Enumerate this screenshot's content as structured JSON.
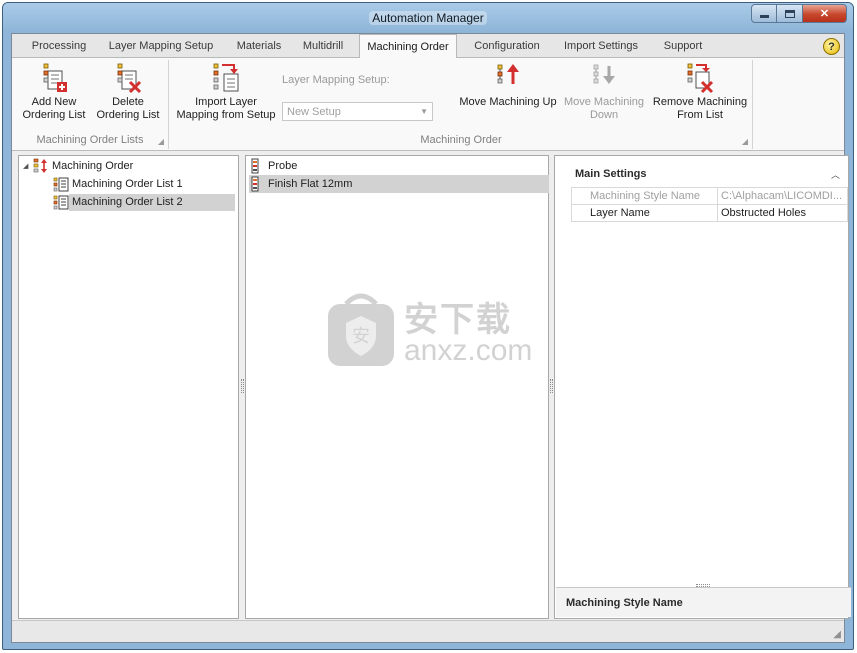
{
  "window": {
    "title": "Automation Manager",
    "controls": {
      "minimize": "minimize-icon",
      "maximize": "maximize-icon",
      "close": "close-icon"
    }
  },
  "tabs": [
    {
      "label": "Processing",
      "active": false
    },
    {
      "label": "Layer Mapping Setup",
      "active": false
    },
    {
      "label": "Materials",
      "active": false
    },
    {
      "label": "Multidrill",
      "active": false
    },
    {
      "label": "Machining Order",
      "active": true
    },
    {
      "label": "Configuration",
      "active": false
    },
    {
      "label": "Import Settings",
      "active": false
    },
    {
      "label": "Support",
      "active": false
    }
  ],
  "help": {
    "glyph": "?"
  },
  "ribbon": {
    "group_lists": {
      "label": "Machining Order Lists",
      "add_label": "Add New\nOrdering List",
      "delete_label": "Delete\nOrdering List"
    },
    "group_order": {
      "label": "Machining Order",
      "import_label": "Import Layer\nMapping from Setup",
      "layer_mapping_label": "Layer Mapping Setup:",
      "layer_mapping_value": "New Setup",
      "move_up_label": "Move Machining Up",
      "move_down_label": "Move Machining\nDown",
      "remove_label": "Remove Machining\nFrom List"
    }
  },
  "tree": {
    "root": "Machining Order",
    "items": [
      {
        "label": "Machining Order List 1",
        "selected": false
      },
      {
        "label": "Machining Order List 2",
        "selected": true
      }
    ]
  },
  "list": {
    "items": [
      {
        "label": "Probe",
        "selected": false
      },
      {
        "label": "Finish Flat 12mm",
        "selected": true
      }
    ]
  },
  "properties": {
    "section": "Main Settings",
    "rows": [
      {
        "name": "Machining Style Name",
        "value": "C:\\Alphacam\\LICOMDI...",
        "readonly": true
      },
      {
        "name": "Layer Name",
        "value": "Obstructed Holes",
        "readonly": false
      }
    ],
    "description_title": "Machining Style Name"
  },
  "watermark": {
    "cn": "安下载",
    "en": "anxz.com"
  },
  "colors": {
    "title_bar": "#8db4d7",
    "close_button": "#c7472c",
    "selection": "#d2d2d2",
    "icon_red": "#d32f2f"
  }
}
